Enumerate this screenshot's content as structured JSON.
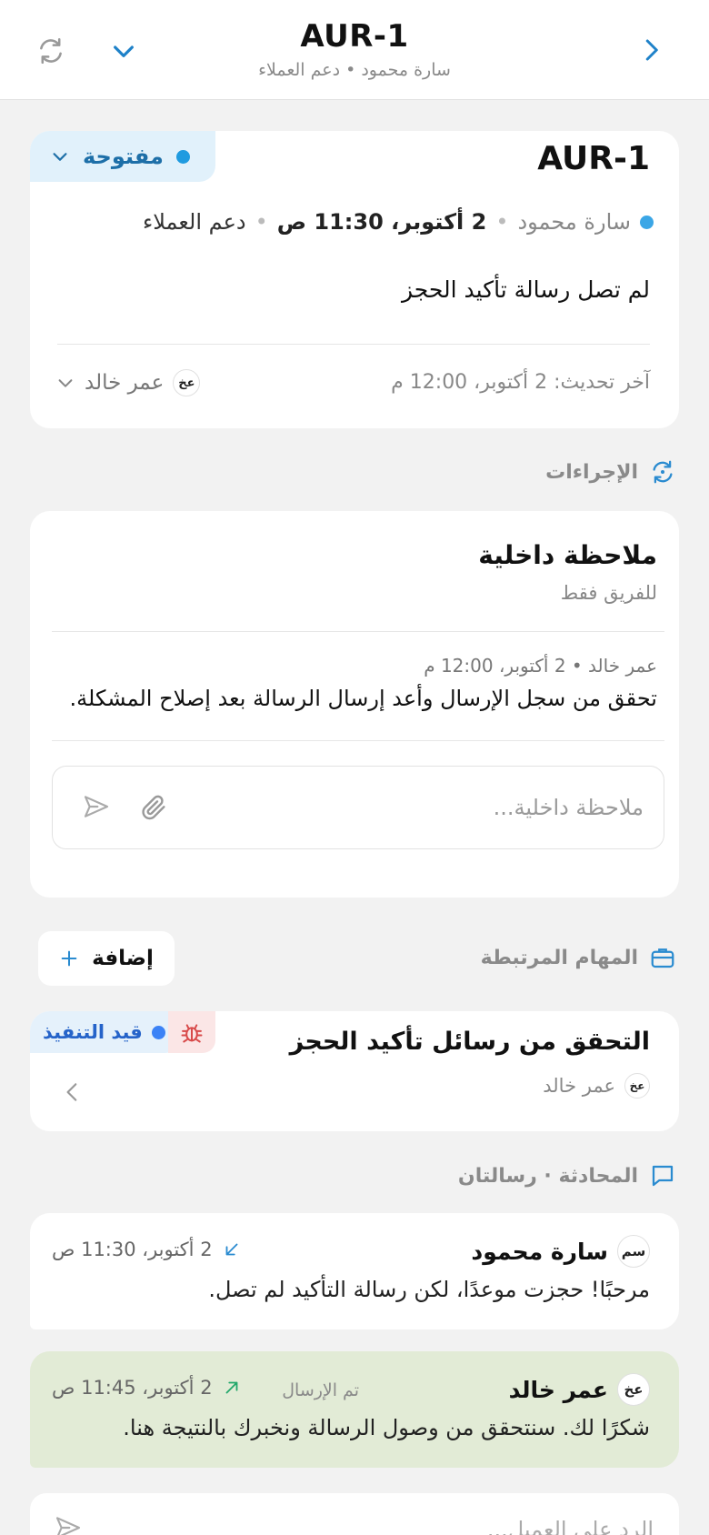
{
  "header": {
    "title": "AUR-1",
    "subtitle": "سارة محمود • دعم العملاء"
  },
  "ticket": {
    "id": "AUR-1",
    "status_label": "مفتوحة",
    "status_color": "#1f9be0",
    "requester": "سارة محمود",
    "created": "2 أكتوبر، 11:30 ص",
    "department": "دعم العملاء",
    "subject": "لم تصل رسالة تأكيد الحجز",
    "updated": "آخر تحديث: 2 أكتوبر، 12:00 م",
    "assignee_initials": "عخ",
    "assignee": "عمر خالد"
  },
  "actions": {
    "heading": "الإجراءات",
    "note_title": "ملاحظة داخلية",
    "note_scope": "للفريق فقط",
    "note_meta": "عمر خالد • 2 أكتوبر، 12:00 م",
    "note_body": "تحقق من سجل الإرسال وأعد إرسال الرسالة بعد إصلاح المشكلة.",
    "input_placeholder": "ملاحظة داخلية..."
  },
  "tasks": {
    "heading": "المهام المرتبطة",
    "add_label": "إضافة",
    "items": [
      {
        "title": "التحقق من رسائل تأكيد الحجز",
        "status": "قيد التنفيذ",
        "status_color": "#3b82f6",
        "assignee_initials": "عخ",
        "assignee": "عمر خالد"
      }
    ]
  },
  "conversation": {
    "heading": "المحادثة · رسالتان",
    "messages": [
      {
        "initials": "سم",
        "sender": "سارة محمود",
        "time": "2 أكتوبر، 11:30 ص",
        "direction": "incoming",
        "text": "مرحبًا! حجزت موعدًا، لكن رسالة التأكيد لم تصل."
      },
      {
        "initials": "عخ",
        "sender": "عمر خالد",
        "state": "تم الإرسال",
        "time": "2 أكتوبر، 11:45 ص",
        "direction": "outgoing",
        "text": "شكرًا لك. سنتحقق من وصول الرسالة ونخبرك بالنتيجة هنا."
      }
    ],
    "reply_placeholder": "الرد على العميل..."
  },
  "colors": {
    "accent": "#1f82c9",
    "outgoing_bg": "#e2ebd6",
    "status_bg": "#e1f1fb"
  }
}
